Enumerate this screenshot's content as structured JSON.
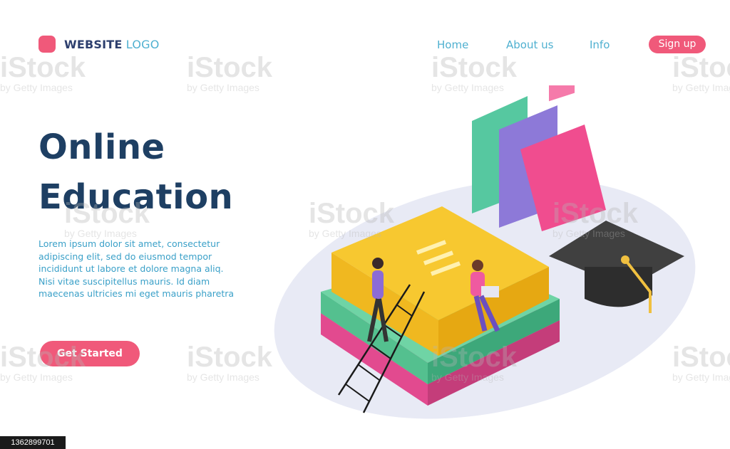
{
  "header": {
    "logo_strong": "WEBSITE",
    "logo_light": "LOGO",
    "nav": [
      {
        "label": "Home"
      },
      {
        "label": "About us"
      },
      {
        "label": "Info"
      }
    ],
    "signup_label": "Sign up"
  },
  "hero": {
    "title_line1": "Online",
    "title_line2": "Education",
    "body_lines": [
      "Lorem ipsum dolor sit amet, consectetur",
      "adipiscing elit, sed do eiusmod tempor",
      "incididunt ut labore et dolore magna aliq.",
      "Nisi vitae suscipitellus mauris. Id diam",
      "maecenas ultricies mi eget mauris pharetra"
    ],
    "cta_label": "Get Started"
  },
  "watermark": {
    "brand": "iStock",
    "credit": "by Getty Images",
    "image_id": "1362899701"
  },
  "colors": {
    "accent": "#f0597a",
    "title": "#1e3f63",
    "link": "#4fb0d0"
  }
}
